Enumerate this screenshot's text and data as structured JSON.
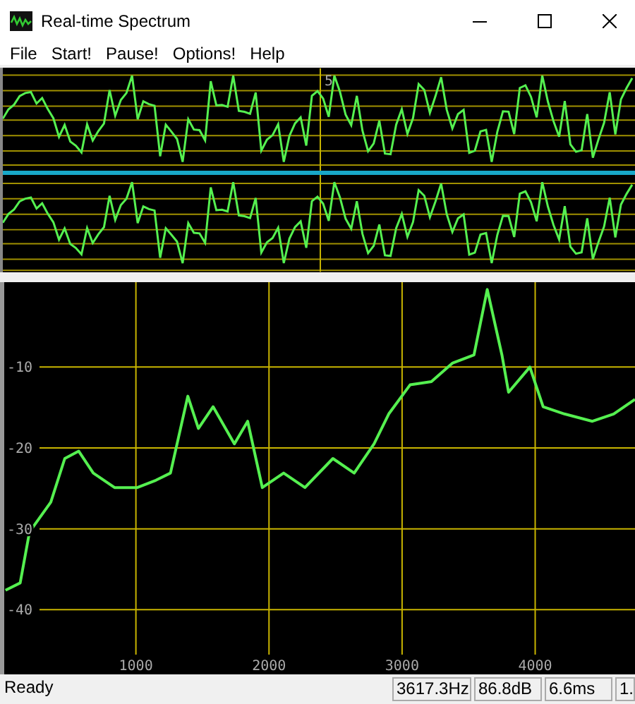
{
  "window": {
    "title": "Real-time Spectrum"
  },
  "menu": [
    "File",
    "Start!",
    "Pause!",
    "Options!",
    "Help"
  ],
  "waveform": {
    "marker_label": "5"
  },
  "spectrum": {
    "chart_data": {
      "type": "line",
      "x": [
        20,
        130,
        200,
        360,
        465,
        570,
        680,
        840,
        1010,
        1150,
        1260,
        1390,
        1470,
        1580,
        1740,
        1840,
        1950,
        2110,
        2270,
        2480,
        2640,
        2790,
        2900,
        3060,
        3220,
        3380,
        3540,
        3640,
        3750,
        3800,
        3960,
        4060,
        4220,
        4430,
        4590,
        4750
      ],
      "series": [
        {
          "color": "#55f050",
          "values": [
            -37.6,
            -36.7,
            -30.4,
            -26.7,
            -21.3,
            -20.4,
            -23.1,
            -24.9,
            -24.9,
            -24,
            -23.1,
            -13.6,
            -17.6,
            -14.9,
            -19.5,
            -16.7,
            -24.9,
            -23.1,
            -24.9,
            -21.3,
            -23.1,
            -19.5,
            -15.8,
            -12.2,
            -11.8,
            -9.5,
            -8.5,
            -0.4,
            -8.5,
            -13.1,
            -10,
            -14.9,
            -15.8,
            -16.7,
            -15.8,
            -14
          ]
        }
      ],
      "grid": true,
      "xlim": [
        0,
        4750
      ],
      "ylim": [
        -48,
        0.5
      ],
      "xticks": [
        1000,
        2000,
        3000,
        4000
      ],
      "yticks": [
        -10,
        -20,
        -30,
        -40
      ]
    }
  },
  "status_bar": [
    "Ready",
    "3617.3Hz",
    "86.8dB",
    "6.6ms",
    "1."
  ]
}
